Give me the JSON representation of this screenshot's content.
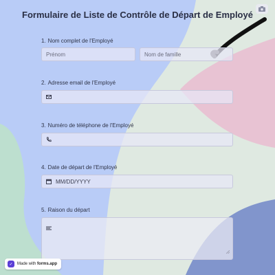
{
  "form": {
    "title": "Formulaire de Liste de Contrôle de Départ de Employé"
  },
  "questions": [
    {
      "number": "1.",
      "label": "Nom complet de l'Employé",
      "first_placeholder": "Prénom",
      "last_placeholder": "Nom de famille"
    },
    {
      "number": "2.",
      "label": "Adresse email de l'Employé"
    },
    {
      "number": "3.",
      "label": "Numéro de téléphone de l'Employé"
    },
    {
      "number": "4.",
      "label": "Date de départ de l'Employé",
      "date_placeholder": "MM/DD/YYYY"
    },
    {
      "number": "5.",
      "label": "Raison du départ"
    }
  ],
  "footer": {
    "made_with": "Made with",
    "brand": "forms.app"
  },
  "icons": {
    "camera": "camera-icon",
    "email": "envelope-icon",
    "phone": "phone-icon",
    "date": "calendar-icon",
    "textarea": "text-lines-icon"
  },
  "colors": {
    "blue_shape": "#b9ccf7",
    "pink_shape": "#e8c3d3",
    "navy_shape": "#8195cc",
    "green_shape": "#bddfcf",
    "bg": "#dfe9e1"
  }
}
